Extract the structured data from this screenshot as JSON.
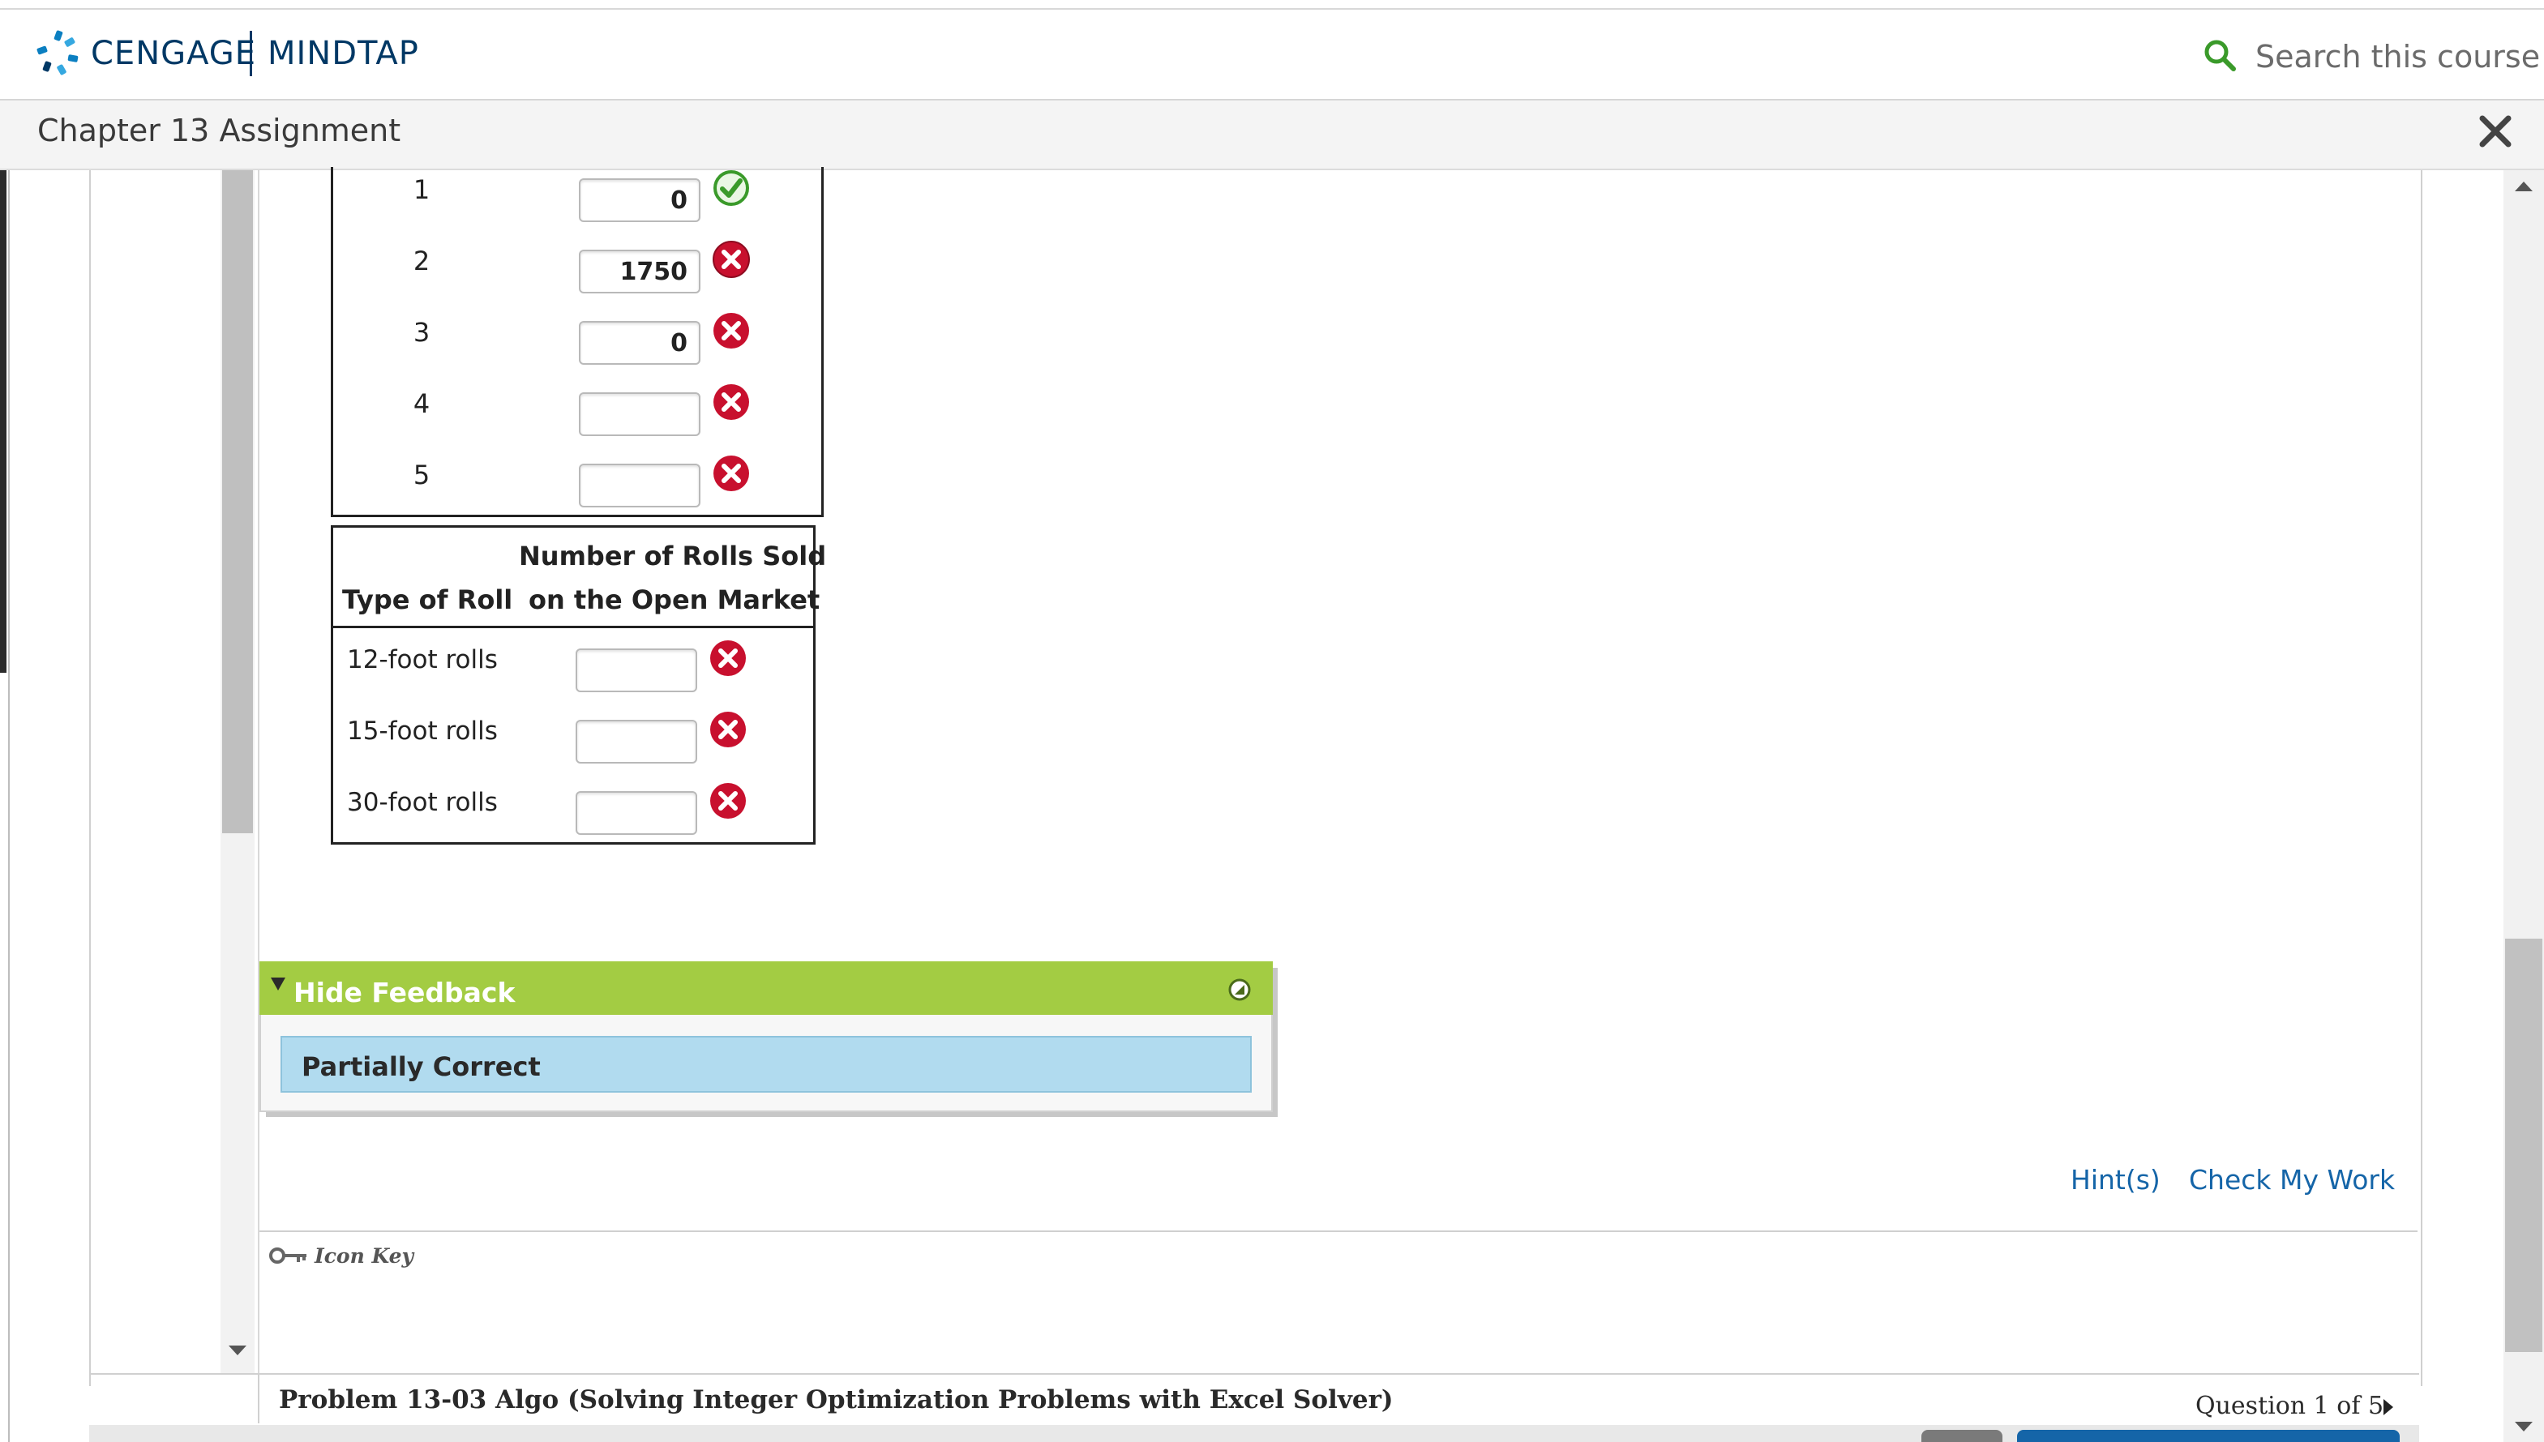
{
  "header": {
    "brand": "CENGAGE",
    "product": "MINDTAP",
    "search_label": "Search this course"
  },
  "titlebar": {
    "title": "Chapter 13 Assignment"
  },
  "table1": {
    "rows": [
      {
        "label": "1",
        "value": "0",
        "status": "correct"
      },
      {
        "label": "2",
        "value": "1750",
        "status": "incorrect"
      },
      {
        "label": "3",
        "value": "0",
        "status": "incorrect"
      },
      {
        "label": "4",
        "value": "",
        "status": "incorrect"
      },
      {
        "label": "5",
        "value": "",
        "status": "incorrect"
      }
    ]
  },
  "table2": {
    "col1_header": "Type of Roll",
    "col2_header_line1": "Number of Rolls Sold",
    "col2_header_line2": "on the Open Market",
    "rows": [
      {
        "label": "12-foot rolls",
        "value": "",
        "status": "incorrect"
      },
      {
        "label": "15-foot rolls",
        "value": "",
        "status": "incorrect"
      },
      {
        "label": "30-foot rolls",
        "value": "",
        "status": "incorrect"
      }
    ]
  },
  "feedback": {
    "toggle_label": "Hide Feedback",
    "message": "Partially Correct"
  },
  "actions": {
    "hint_label": "Hint(s)",
    "check_label": "Check My Work"
  },
  "icon_key": {
    "label": "Icon Key"
  },
  "footer": {
    "problem_title": "Problem 13-03 Algo (Solving Integer Optimization Problems with Excel Solver)",
    "question_counter": "Question 1 of 5"
  },
  "colors": {
    "brand": "#003865",
    "feedback_green": "#a3cc43",
    "message_blue": "#b1dbef",
    "link_blue": "#1565a8",
    "correct_green": "#3a9a2a",
    "incorrect_red": "#c8102e"
  }
}
